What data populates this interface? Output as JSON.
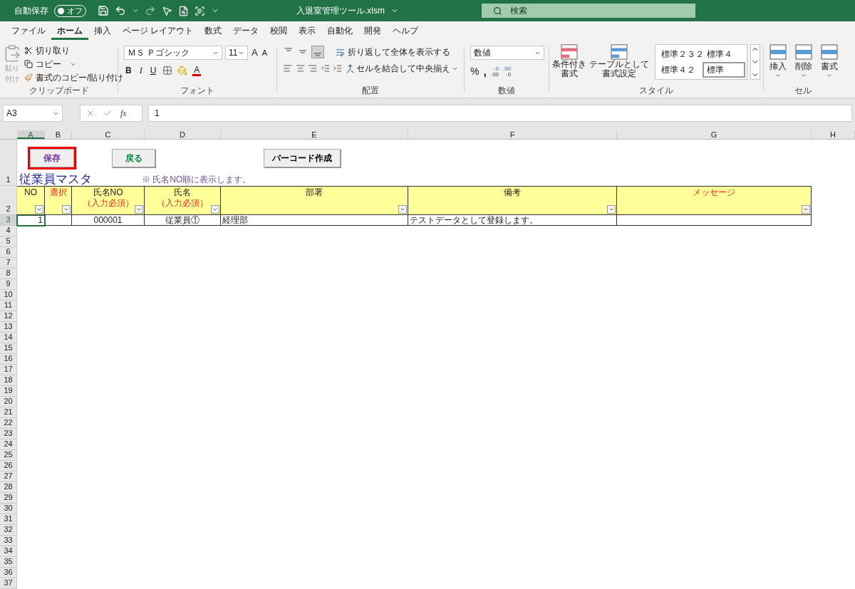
{
  "title_bar": {
    "autosave_label": "自動保存",
    "autosave_toggle": {
      "label": "オフ",
      "on": false
    },
    "filename": "入退室管理ツール.xlsm",
    "search": {
      "placeholder": "検索"
    }
  },
  "ribbon_tabs": [
    {
      "label": "ファイル",
      "selected": false
    },
    {
      "label": "ホーム",
      "selected": true
    },
    {
      "label": "挿入",
      "selected": false
    },
    {
      "label": "ページ レイアウト",
      "selected": false
    },
    {
      "label": "数式",
      "selected": false
    },
    {
      "label": "データ",
      "selected": false
    },
    {
      "label": "校閲",
      "selected": false
    },
    {
      "label": "表示",
      "selected": false
    },
    {
      "label": "自動化",
      "selected": false
    },
    {
      "label": "開発",
      "selected": false
    },
    {
      "label": "ヘルプ",
      "selected": false
    }
  ],
  "clipboard": {
    "paste": "貼り付け",
    "cut": "切り取り",
    "copy": "コピー",
    "format_painter": "書式のコピー/貼り付け",
    "label": "クリップボード"
  },
  "font": {
    "font_name": "ＭＳ Ｐゴシック",
    "font_size": "11",
    "grow": "A",
    "shrink": "A",
    "bold": "B",
    "italic": "I",
    "underline": "U",
    "font_color": "A",
    "label": "フォント"
  },
  "alignment": {
    "wrap_text": "折り返して全体を表示する",
    "merge": "セルを結合して中央揃え",
    "label": "配置"
  },
  "number": {
    "format": "数値",
    "percent": "%",
    "comma": ",",
    "decimals": [
      {
        "top": ".0",
        "bottom": ".00"
      },
      {
        "top": ".00",
        "bottom": ".0"
      }
    ],
    "label": "数値"
  },
  "styles": {
    "conditional": [
      "条件付き",
      "書式"
    ],
    "table": [
      "テーブルとして",
      "書式設定"
    ],
    "gallery": [
      {
        "label": "標準２３２",
        "selected": false
      },
      {
        "label": "標準４",
        "selected": false
      },
      {
        "label": "標準４２",
        "selected": false
      },
      {
        "label": "標準",
        "selected": true
      }
    ],
    "label": "スタイル"
  },
  "cells": {
    "buttons": [
      "挿入",
      "削除",
      "書式"
    ],
    "label": "セル"
  },
  "formula_bar": {
    "name_box": "A3",
    "fx": "fx",
    "formula": "1"
  },
  "sheet": {
    "columns": [
      {
        "label": "A",
        "selected": true
      },
      {
        "label": "B",
        "selected": false
      },
      {
        "label": "C",
        "selected": false
      },
      {
        "label": "D",
        "selected": false
      },
      {
        "label": "E",
        "selected": false
      },
      {
        "label": "F",
        "selected": false
      },
      {
        "label": "G",
        "selected": false
      },
      {
        "label": "H",
        "selected": false
      }
    ],
    "rows": [
      {
        "label": "1",
        "selected": false
      },
      {
        "label": "2",
        "selected": false
      },
      {
        "label": "3",
        "selected": true
      },
      {
        "label": "4",
        "selected": false
      },
      {
        "label": "5",
        "selected": false
      },
      {
        "label": "6",
        "selected": false
      },
      {
        "label": "7",
        "selected": false
      },
      {
        "label": "8",
        "selected": false
      },
      {
        "label": "9",
        "selected": false
      },
      {
        "label": "10",
        "selected": false
      },
      {
        "label": "11",
        "selected": false
      },
      {
        "label": "12",
        "selected": false
      },
      {
        "label": "13",
        "selected": false
      },
      {
        "label": "14",
        "selected": false
      },
      {
        "label": "15",
        "selected": false
      },
      {
        "label": "16",
        "selected": false
      },
      {
        "label": "17",
        "selected": false
      },
      {
        "label": "18",
        "selected": false
      },
      {
        "label": "19",
        "selected": false
      },
      {
        "label": "20",
        "selected": false
      },
      {
        "label": "21",
        "selected": false
      },
      {
        "label": "22",
        "selected": false
      },
      {
        "label": "23",
        "selected": false
      },
      {
        "label": "24",
        "selected": false
      },
      {
        "label": "25",
        "selected": false
      },
      {
        "label": "26",
        "selected": false
      },
      {
        "label": "27",
        "selected": false
      },
      {
        "label": "28",
        "selected": false
      },
      {
        "label": "29",
        "selected": false
      },
      {
        "label": "30",
        "selected": false
      },
      {
        "label": "31",
        "selected": false
      },
      {
        "label": "32",
        "selected": false
      },
      {
        "label": "33",
        "selected": false
      },
      {
        "label": "34",
        "selected": false
      },
      {
        "label": "35",
        "selected": false
      },
      {
        "label": "36",
        "selected": false
      },
      {
        "label": "37",
        "selected": false
      }
    ],
    "buttons": [
      {
        "label": "保存",
        "color": "#7030a0",
        "selected": true
      },
      {
        "label": "戻る",
        "color": "#00843d",
        "selected": false
      },
      {
        "label": "バーコード作成",
        "color": "#000000",
        "selected": false
      }
    ],
    "title": "従業員マスタ",
    "note": "※ 氏名NO順に表示します。",
    "headers": [
      {
        "label": "NO",
        "red": false
      },
      {
        "label": "選択",
        "red": true
      },
      {
        "label": "氏名NO",
        "required": "（入力必須）",
        "red": false
      },
      {
        "label": "氏名",
        "required": "（入力必須）",
        "red": false
      },
      {
        "label": "部署",
        "red": false
      },
      {
        "label": "備考",
        "red": false
      },
      {
        "label": "メッセージ",
        "red": true
      }
    ],
    "data_row": {
      "A": "1",
      "C": "000001",
      "D": "従業員①",
      "E": "経理部",
      "F": "テストデータとして登録します。"
    }
  }
}
